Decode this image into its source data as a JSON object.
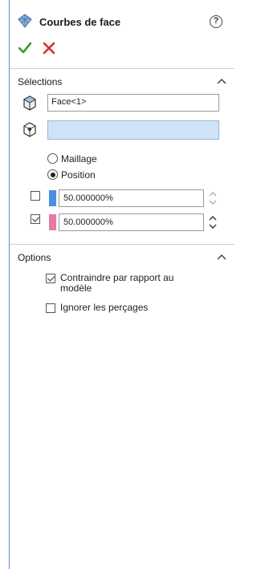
{
  "header": {
    "title": "Courbes de face",
    "help_glyph": "?",
    "title_icon": "surface-mesh-icon",
    "ok_icon": "checkmark-icon",
    "cancel_icon": "x-icon"
  },
  "colors": {
    "accent_border": "#5a8fcf",
    "ok_green": "#3a9a2c",
    "cancel_red": "#d6302a",
    "selection_blue": "#cfe3f7",
    "swatch_blue": "#4a90e2",
    "swatch_pink": "#e878a8"
  },
  "selections": {
    "title": "Sélections",
    "face_field_value": "Face<1>",
    "vertex_field_value": "",
    "mode_options": [
      {
        "label": "Maillage",
        "checked": false
      },
      {
        "label": "Position",
        "checked": true
      }
    ],
    "directions": [
      {
        "checked": false,
        "value": "50.000000%",
        "swatch": "blue"
      },
      {
        "checked": true,
        "value": "50.000000%",
        "swatch": "pink"
      }
    ]
  },
  "options": {
    "title": "Options",
    "items": [
      {
        "label": "Contraindre par rapport au modèle",
        "checked": true
      },
      {
        "label": "Ignorer les perçages",
        "checked": false
      }
    ]
  }
}
